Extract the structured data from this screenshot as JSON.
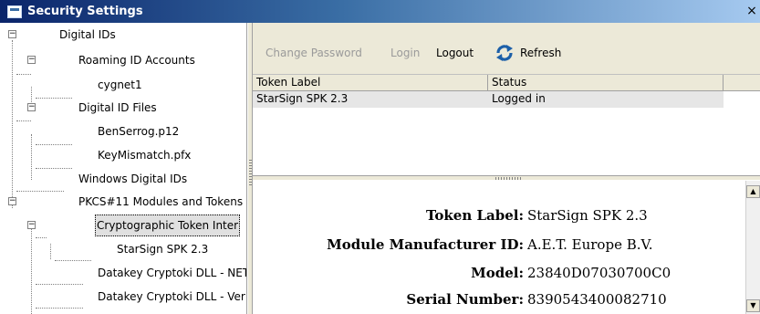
{
  "window": {
    "title": "Security Settings",
    "close_glyph": "×"
  },
  "tree": {
    "items": [
      {
        "label": "Digital IDs",
        "expander": "−"
      },
      {
        "label": "Roaming ID Accounts",
        "expander": "−"
      },
      {
        "label": "cygnet1"
      },
      {
        "label": "Digital ID Files",
        "expander": "−"
      },
      {
        "label": "BenSerrog.p12"
      },
      {
        "label": "KeyMismatch.pfx"
      },
      {
        "label": "Windows Digital IDs"
      },
      {
        "label": "PKCS#11 Modules and Tokens",
        "expander": "−"
      },
      {
        "label": "Cryptographic Token Inter",
        "expander": "−"
      },
      {
        "label": "StarSign SPK 2.3"
      },
      {
        "label": "Datakey Cryptoki DLL - NET"
      },
      {
        "label": "Datakey Cryptoki DLL - Ver"
      }
    ]
  },
  "toolbar": {
    "change_password": "Change Password",
    "login": "Login",
    "logout": "Logout",
    "refresh": "Refresh",
    "refresh_icon": "refresh-icon"
  },
  "table": {
    "headers": [
      "Token Label",
      "Status"
    ],
    "rows": [
      [
        "StarSign SPK 2.3",
        "Logged in"
      ]
    ]
  },
  "details": {
    "rows": [
      {
        "label": "Token Label:",
        "value": "StarSign SPK 2.3"
      },
      {
        "label": "Module Manufacturer ID:",
        "value": "A.E.T. Europe B.V."
      },
      {
        "label": "Model:",
        "value": "23840D07030700C0"
      },
      {
        "label": "Serial Number:",
        "value": "8390543400082710"
      }
    ]
  },
  "colors": {
    "titlebar_start": "#0a246a",
    "titlebar_end": "#a6caf0",
    "toolbar_bg": "#ece9d8",
    "selected_row_bg": "#e6e6e6",
    "disabled_text": "#9a9a9a",
    "refresh_icon": "#1c5fa8"
  }
}
